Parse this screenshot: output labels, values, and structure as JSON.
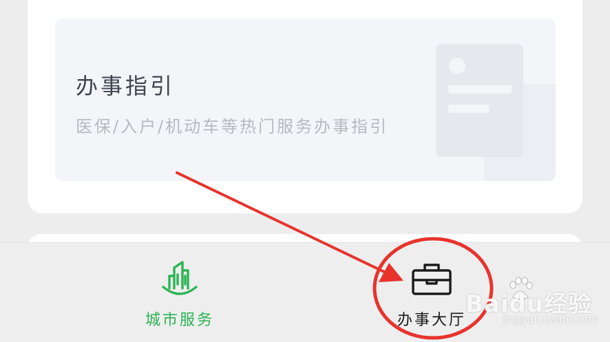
{
  "guide": {
    "title": "办事指引",
    "subtitle": "医保/入户/机动车等热门服务办事指引"
  },
  "tabbar": {
    "tabs": [
      {
        "label": "城市服务",
        "icon": "city-building-icon",
        "color": "#2bb453",
        "active": true
      },
      {
        "label": "办事大厅",
        "icon": "briefcase-icon",
        "color": "#1a1a1a",
        "active": false
      }
    ]
  },
  "annotation": {
    "arrow_color": "#e8332d",
    "circle_color": "#e8332d"
  },
  "watermark": {
    "logo": "Baidu经验",
    "url": "jingyan.baidu.com"
  }
}
